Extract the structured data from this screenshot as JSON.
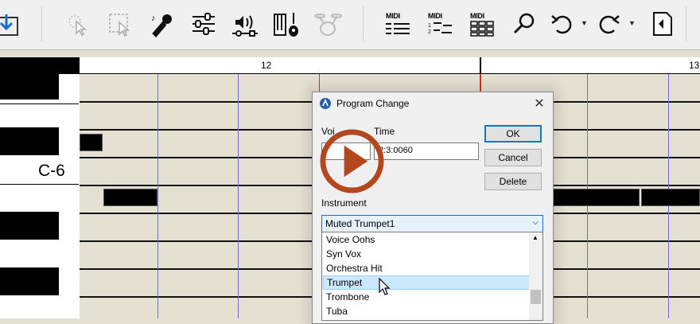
{
  "toolbar": {
    "buttons": [
      {
        "id": "save",
        "icon": "save-down-icon"
      },
      {
        "id": "select",
        "icon": "pointer-select-icon"
      },
      {
        "id": "marquee",
        "icon": "marquee-select-icon"
      },
      {
        "id": "notes",
        "icon": "microphone-notes-icon"
      },
      {
        "id": "mixer",
        "icon": "sliders-icon"
      },
      {
        "id": "audio",
        "icon": "speaker-waveform-icon"
      },
      {
        "id": "instruments",
        "icon": "keyboard-guitar-icon"
      },
      {
        "id": "drums",
        "icon": "drum-kit-icon"
      },
      {
        "id": "midi1",
        "icon": "midi-list-icon",
        "label": "MIDI"
      },
      {
        "id": "midi2",
        "icon": "midi-staff-icon",
        "label": "MIDI"
      },
      {
        "id": "midi3",
        "icon": "midi-grid-icon",
        "label": "MIDI"
      },
      {
        "id": "zoom",
        "icon": "magnifier-icon"
      },
      {
        "id": "undo",
        "icon": "undo-icon"
      },
      {
        "id": "redo",
        "icon": "redo-icon"
      },
      {
        "id": "close-doc",
        "icon": "document-back-icon"
      }
    ]
  },
  "ruler": {
    "measure_12": "12",
    "measure_13": "13"
  },
  "keyboard": {
    "c6_label": "C-6"
  },
  "dialog": {
    "title": "Program Change",
    "voice_label": "Voi",
    "time_label": "Time",
    "time_value": "2:3:0060",
    "instrument_label": "Instrument",
    "selected_instrument": "Muted Trumpet1",
    "ok": "OK",
    "cancel": "Cancel",
    "delete": "Delete",
    "close": "✕",
    "instrument_list": [
      "Voice Oohs",
      "Syn Vox",
      "Orchestra Hit",
      "Trumpet",
      "Trombone",
      "Tuba"
    ],
    "highlighted_item": "Trumpet"
  },
  "overlay": {
    "play_icon": "play-circle-icon"
  },
  "colors": {
    "grid_bg": "#e4e1d3",
    "accent": "#0078d7",
    "playhead": "#c8352a",
    "beat_line": "#6c6cd8",
    "play_overlay": "#b5471f"
  }
}
